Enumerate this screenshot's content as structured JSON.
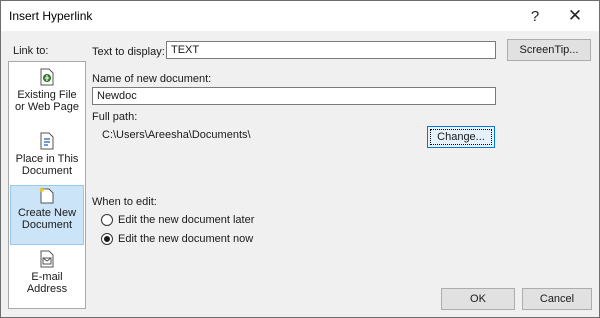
{
  "window": {
    "title": "Insert Hyperlink",
    "help_glyph": "?",
    "close_glyph": "✕"
  },
  "link_to": {
    "label": "Link to:",
    "items": [
      {
        "line1": "Existing File",
        "line2": "or Web Page",
        "icon": "existing-file-icon"
      },
      {
        "line1": "Place in This",
        "line2": "Document",
        "icon": "place-in-document-icon"
      },
      {
        "line1": "Create New",
        "line2": "Document",
        "icon": "create-new-document-icon",
        "selected": true
      },
      {
        "line1": "E-mail",
        "line2": "Address",
        "icon": "email-icon"
      }
    ]
  },
  "text_to_display": {
    "label": "Text to display:",
    "value": "TEXT"
  },
  "screentip_button": "ScreenTip...",
  "new_document": {
    "label": "Name of new document:",
    "value": "Newdoc"
  },
  "full_path": {
    "label": "Full path:",
    "value": "C:\\Users\\Areesha\\Documents\\"
  },
  "change_button": "Change...",
  "when_to_edit": {
    "label": "When to edit:",
    "options": [
      {
        "label": "Edit the new document later",
        "selected": false
      },
      {
        "label": "Edit the new document now",
        "selected": true
      }
    ]
  },
  "ok_button": "OK",
  "cancel_button": "Cancel",
  "colors": {
    "selected_bg": "#cce4f7",
    "focus_border": "#0078d7"
  }
}
